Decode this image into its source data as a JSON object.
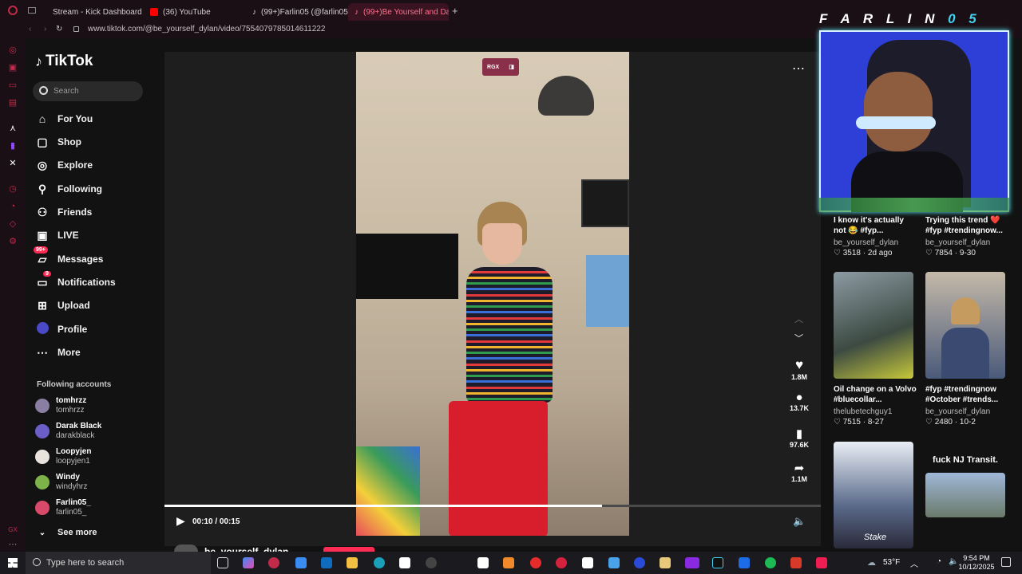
{
  "browser": {
    "tabs": [
      {
        "label": "Stream - Kick Dashboard",
        "color": "#53fc18"
      },
      {
        "label": "(36) YouTube",
        "color": "#ff0000"
      },
      {
        "label": "(99+)Farlin05 (@farlin05",
        "color": "#ffffff"
      },
      {
        "label": "(99+)Be Yourself and Dan",
        "color": "#ff3a5c"
      }
    ],
    "url": "www.tiktok.com/@be_yourself_dylan/video/7554079785014611222"
  },
  "overlay": {
    "streamer_name": "F A R L I N",
    "streamer_suffix": "0 5"
  },
  "tiktok": {
    "logo": "TikTok",
    "search_placeholder": "Search",
    "nav": [
      {
        "label": "For You",
        "icon": "home-icon"
      },
      {
        "label": "Shop",
        "icon": "shop-icon"
      },
      {
        "label": "Explore",
        "icon": "compass-icon"
      },
      {
        "label": "Following",
        "icon": "following-icon"
      },
      {
        "label": "Friends",
        "icon": "friends-icon"
      },
      {
        "label": "LIVE",
        "icon": "live-icon"
      },
      {
        "label": "Messages",
        "icon": "messages-icon",
        "badge": "99+"
      },
      {
        "label": "Notifications",
        "icon": "notifications-icon",
        "badge": "9"
      },
      {
        "label": "Upload",
        "icon": "upload-icon"
      },
      {
        "label": "Profile",
        "icon": "profile-icon"
      },
      {
        "label": "More",
        "icon": "more-icon"
      }
    ],
    "following_title": "Following accounts",
    "following": [
      {
        "name": "tomhrzz",
        "handle": "tomhrzz",
        "color": "#8a7fa3"
      },
      {
        "name": "Darak Black",
        "handle": "darakblack",
        "color": "#6b5fc7"
      },
      {
        "name": "Loopyjen",
        "handle": "loopyjen1",
        "color": "#e8e2dc"
      },
      {
        "name": "Windy",
        "handle": "windyhrz",
        "color": "#7db24a"
      },
      {
        "name": "Farlin05_",
        "handle": "farlin05_",
        "color": "#d94a6a"
      }
    ],
    "see_more": "See more",
    "player": {
      "time": "00:10 / 00:15",
      "progress": 0.667,
      "rgx_label": "RGX"
    },
    "actions": [
      {
        "icon": "heart-icon",
        "count": "1.8M"
      },
      {
        "icon": "comment-icon",
        "count": "13.7K"
      },
      {
        "icon": "bookmark-icon",
        "count": "97.6K"
      },
      {
        "icon": "share-icon",
        "count": "1.1M"
      }
    ],
    "author_partial": "be_yourself_dylan"
  },
  "recommended": [
    {
      "title": "I know it's actually not 😂 #fyp...",
      "user": "be_yourself_dylan",
      "stats": "♡ 3518 · 2d ago"
    },
    {
      "title": "Trying this trend ❤️ #fyp #trendingnow...",
      "user": "be_yourself_dylan",
      "stats": "♡ 7854 · 9-30"
    },
    {
      "title": "Oil change on a Volvo #bluecollar...",
      "user": "thelubetechguy1",
      "stats": "♡ 7515 · 8-27"
    },
    {
      "title": "#fyp #trendingnow #October #trends...",
      "user": "be_yourself_dylan",
      "stats": "♡ 2480 · 10-2"
    },
    {
      "title": "fuck NJ Transit.",
      "thumb_text": "Stake"
    }
  ],
  "taskbar": {
    "search_placeholder": "Type here to search",
    "weather": "53°F",
    "time": "9:54 PM",
    "date": "10/12/2025"
  }
}
